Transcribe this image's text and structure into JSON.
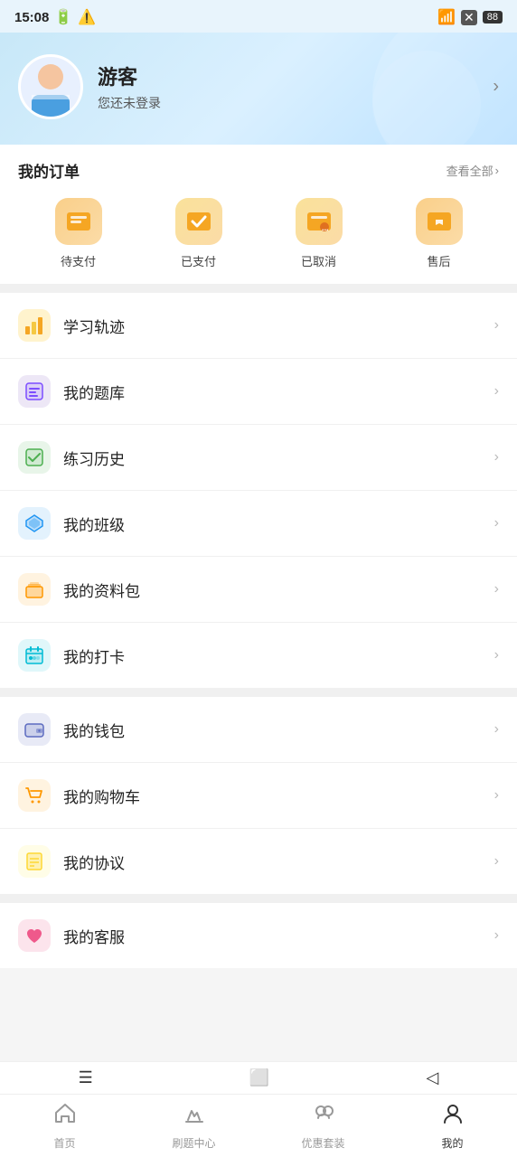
{
  "statusBar": {
    "time": "15:08",
    "wifi": "📶",
    "battery": "88"
  },
  "profile": {
    "name": "游客",
    "subtitle": "您还未登录",
    "arrowLabel": ">"
  },
  "orders": {
    "sectionTitle": "我的订单",
    "viewAll": "查看全部",
    "items": [
      {
        "icon": "💼",
        "label": "待支付",
        "color": "orange"
      },
      {
        "icon": "✅",
        "label": "已支付",
        "color": "amber"
      },
      {
        "icon": "📋",
        "label": "已取消",
        "color": "amber"
      },
      {
        "icon": "↩️",
        "label": "售后",
        "color": "orange"
      }
    ]
  },
  "menuGroups": [
    {
      "items": [
        {
          "icon": "📊",
          "label": "学习轨迹",
          "iconColor": "yellow"
        },
        {
          "icon": "📘",
          "label": "我的题库",
          "iconColor": "purple"
        },
        {
          "icon": "📝",
          "label": "练习历史",
          "iconColor": "green"
        },
        {
          "icon": "🎓",
          "label": "我的班级",
          "iconColor": "blue"
        },
        {
          "icon": "📁",
          "label": "我的资料包",
          "iconColor": "orange"
        },
        {
          "icon": "📅",
          "label": "我的打卡",
          "iconColor": "cyan"
        }
      ]
    },
    {
      "items": [
        {
          "icon": "👛",
          "label": "我的钱包",
          "iconColor": "indigo"
        },
        {
          "icon": "🛒",
          "label": "我的购物车",
          "iconColor": "cart"
        },
        {
          "icon": "📃",
          "label": "我的协议",
          "iconColor": "contract"
        }
      ]
    },
    {
      "items": [
        {
          "icon": "❤️",
          "label": "我的客服",
          "iconColor": "heart"
        }
      ]
    }
  ],
  "bottomNav": {
    "items": [
      {
        "icon": "🏠",
        "label": "首页",
        "active": false
      },
      {
        "icon": "✏️",
        "label": "刷题中心",
        "active": false
      },
      {
        "icon": "👥",
        "label": "优惠套装",
        "active": false
      },
      {
        "icon": "👤",
        "label": "我的",
        "active": true
      }
    ]
  }
}
